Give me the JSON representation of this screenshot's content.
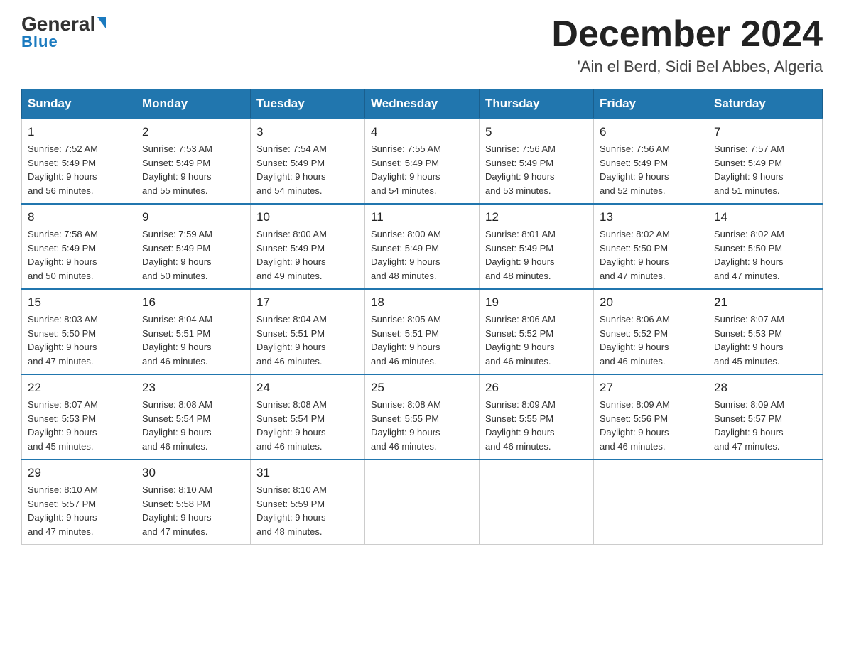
{
  "logo": {
    "general": "General",
    "blue": "Blue",
    "arrow": "▶"
  },
  "header": {
    "month_year": "December 2024",
    "location": "'Ain el Berd, Sidi Bel Abbes, Algeria"
  },
  "days_of_week": [
    "Sunday",
    "Monday",
    "Tuesday",
    "Wednesday",
    "Thursday",
    "Friday",
    "Saturday"
  ],
  "weeks": [
    [
      {
        "day": "1",
        "sunrise": "7:52 AM",
        "sunset": "5:49 PM",
        "daylight": "9 hours and 56 minutes."
      },
      {
        "day": "2",
        "sunrise": "7:53 AM",
        "sunset": "5:49 PM",
        "daylight": "9 hours and 55 minutes."
      },
      {
        "day": "3",
        "sunrise": "7:54 AM",
        "sunset": "5:49 PM",
        "daylight": "9 hours and 54 minutes."
      },
      {
        "day": "4",
        "sunrise": "7:55 AM",
        "sunset": "5:49 PM",
        "daylight": "9 hours and 54 minutes."
      },
      {
        "day": "5",
        "sunrise": "7:56 AM",
        "sunset": "5:49 PM",
        "daylight": "9 hours and 53 minutes."
      },
      {
        "day": "6",
        "sunrise": "7:56 AM",
        "sunset": "5:49 PM",
        "daylight": "9 hours and 52 minutes."
      },
      {
        "day": "7",
        "sunrise": "7:57 AM",
        "sunset": "5:49 PM",
        "daylight": "9 hours and 51 minutes."
      }
    ],
    [
      {
        "day": "8",
        "sunrise": "7:58 AM",
        "sunset": "5:49 PM",
        "daylight": "9 hours and 50 minutes."
      },
      {
        "day": "9",
        "sunrise": "7:59 AM",
        "sunset": "5:49 PM",
        "daylight": "9 hours and 50 minutes."
      },
      {
        "day": "10",
        "sunrise": "8:00 AM",
        "sunset": "5:49 PM",
        "daylight": "9 hours and 49 minutes."
      },
      {
        "day": "11",
        "sunrise": "8:00 AM",
        "sunset": "5:49 PM",
        "daylight": "9 hours and 48 minutes."
      },
      {
        "day": "12",
        "sunrise": "8:01 AM",
        "sunset": "5:49 PM",
        "daylight": "9 hours and 48 minutes."
      },
      {
        "day": "13",
        "sunrise": "8:02 AM",
        "sunset": "5:50 PM",
        "daylight": "9 hours and 47 minutes."
      },
      {
        "day": "14",
        "sunrise": "8:02 AM",
        "sunset": "5:50 PM",
        "daylight": "9 hours and 47 minutes."
      }
    ],
    [
      {
        "day": "15",
        "sunrise": "8:03 AM",
        "sunset": "5:50 PM",
        "daylight": "9 hours and 47 minutes."
      },
      {
        "day": "16",
        "sunrise": "8:04 AM",
        "sunset": "5:51 PM",
        "daylight": "9 hours and 46 minutes."
      },
      {
        "day": "17",
        "sunrise": "8:04 AM",
        "sunset": "5:51 PM",
        "daylight": "9 hours and 46 minutes."
      },
      {
        "day": "18",
        "sunrise": "8:05 AM",
        "sunset": "5:51 PM",
        "daylight": "9 hours and 46 minutes."
      },
      {
        "day": "19",
        "sunrise": "8:06 AM",
        "sunset": "5:52 PM",
        "daylight": "9 hours and 46 minutes."
      },
      {
        "day": "20",
        "sunrise": "8:06 AM",
        "sunset": "5:52 PM",
        "daylight": "9 hours and 46 minutes."
      },
      {
        "day": "21",
        "sunrise": "8:07 AM",
        "sunset": "5:53 PM",
        "daylight": "9 hours and 45 minutes."
      }
    ],
    [
      {
        "day": "22",
        "sunrise": "8:07 AM",
        "sunset": "5:53 PM",
        "daylight": "9 hours and 45 minutes."
      },
      {
        "day": "23",
        "sunrise": "8:08 AM",
        "sunset": "5:54 PM",
        "daylight": "9 hours and 46 minutes."
      },
      {
        "day": "24",
        "sunrise": "8:08 AM",
        "sunset": "5:54 PM",
        "daylight": "9 hours and 46 minutes."
      },
      {
        "day": "25",
        "sunrise": "8:08 AM",
        "sunset": "5:55 PM",
        "daylight": "9 hours and 46 minutes."
      },
      {
        "day": "26",
        "sunrise": "8:09 AM",
        "sunset": "5:55 PM",
        "daylight": "9 hours and 46 minutes."
      },
      {
        "day": "27",
        "sunrise": "8:09 AM",
        "sunset": "5:56 PM",
        "daylight": "9 hours and 46 minutes."
      },
      {
        "day": "28",
        "sunrise": "8:09 AM",
        "sunset": "5:57 PM",
        "daylight": "9 hours and 47 minutes."
      }
    ],
    [
      {
        "day": "29",
        "sunrise": "8:10 AM",
        "sunset": "5:57 PM",
        "daylight": "9 hours and 47 minutes."
      },
      {
        "day": "30",
        "sunrise": "8:10 AM",
        "sunset": "5:58 PM",
        "daylight": "9 hours and 47 minutes."
      },
      {
        "day": "31",
        "sunrise": "8:10 AM",
        "sunset": "5:59 PM",
        "daylight": "9 hours and 48 minutes."
      },
      null,
      null,
      null,
      null
    ]
  ],
  "labels": {
    "sunrise": "Sunrise:",
    "sunset": "Sunset:",
    "daylight": "Daylight:"
  }
}
